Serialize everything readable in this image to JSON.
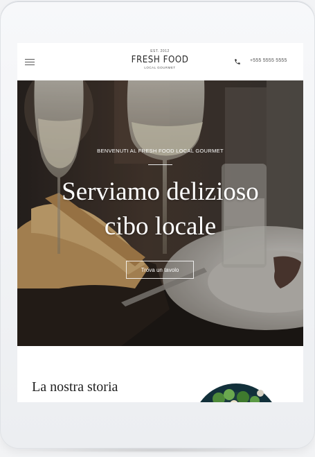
{
  "header": {
    "logo_est": "EST. 2012",
    "logo_main": "FRESH FOOD",
    "logo_sub": "LOCAL GOURMET",
    "phone": "+555 5555 5555",
    "menu_icon": "hamburger-icon",
    "phone_icon": "phone-icon"
  },
  "hero": {
    "eyebrow": "BENVENUTI AL FRESH FOOD LOCAL GOURMET",
    "title_line1": "Serviamo delizioso",
    "title_line2": "cibo locale",
    "cta": "Trova un tavolo"
  },
  "story": {
    "title": "La nostra storia"
  },
  "colors": {
    "text_dark": "#2a2a2a",
    "white": "#ffffff",
    "frame": "#eceef1"
  }
}
